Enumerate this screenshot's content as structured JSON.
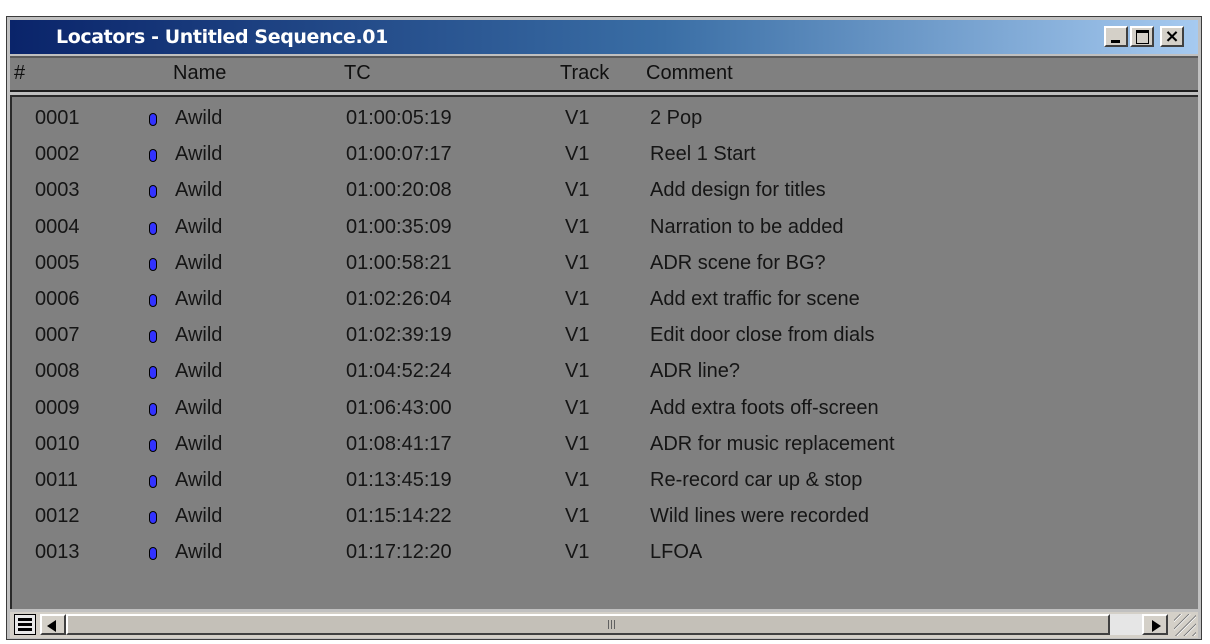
{
  "window": {
    "title": "Locators - Untitled Sequence.01"
  },
  "columns": {
    "num": "#",
    "name": "Name",
    "tc": "TC",
    "track": "Track",
    "comment": "Comment"
  },
  "rows": [
    {
      "num": "0001",
      "name": "Awild",
      "tc": "01:00:05:19",
      "track": "V1",
      "comment": "2 Pop"
    },
    {
      "num": "0002",
      "name": "Awild",
      "tc": "01:00:07:17",
      "track": "V1",
      "comment": "Reel 1 Start"
    },
    {
      "num": "0003",
      "name": "Awild",
      "tc": "01:00:20:08",
      "track": "V1",
      "comment": "Add design for titles"
    },
    {
      "num": "0004",
      "name": "Awild",
      "tc": "01:00:35:09",
      "track": "V1",
      "comment": "Narration to be added"
    },
    {
      "num": "0005",
      "name": "Awild",
      "tc": "01:00:58:21",
      "track": "V1",
      "comment": "ADR scene for BG?"
    },
    {
      "num": "0006",
      "name": "Awild",
      "tc": "01:02:26:04",
      "track": "V1",
      "comment": "Add ext traffic for scene"
    },
    {
      "num": "0007",
      "name": "Awild",
      "tc": "01:02:39:19",
      "track": "V1",
      "comment": "Edit door close from dials"
    },
    {
      "num": "0008",
      "name": "Awild",
      "tc": "01:04:52:24",
      "track": "V1",
      "comment": "ADR line?"
    },
    {
      "num": "0009",
      "name": "Awild",
      "tc": "01:06:43:00",
      "track": "V1",
      "comment": "Add extra foots off-screen"
    },
    {
      "num": "0010",
      "name": "Awild",
      "tc": "01:08:41:17",
      "track": "V1",
      "comment": "ADR for music replacement"
    },
    {
      "num": "0011",
      "name": "Awild",
      "tc": "01:13:45:19",
      "track": "V1",
      "comment": "Re-record car up & stop"
    },
    {
      "num": "0012",
      "name": "Awild",
      "tc": "01:15:14:22",
      "track": "V1",
      "comment": "Wild lines were recorded"
    },
    {
      "num": "0013",
      "name": "Awild",
      "tc": "01:17:12:20",
      "track": "V1",
      "comment": "LFOA"
    }
  ],
  "icons": {
    "title_buttons": [
      "minimize-icon",
      "maximize-icon",
      "close-icon"
    ],
    "locator_marker": "blue-locator-dot-icon",
    "scroll": [
      "list-menu-icon",
      "scroll-left-arrow-icon",
      "scroll-right-arrow-icon",
      "resize-grip-icon"
    ]
  },
  "colors": {
    "titlebar_start": "#0a246a",
    "list_bg": "#808080",
    "locator_marker": "#3232ff"
  }
}
